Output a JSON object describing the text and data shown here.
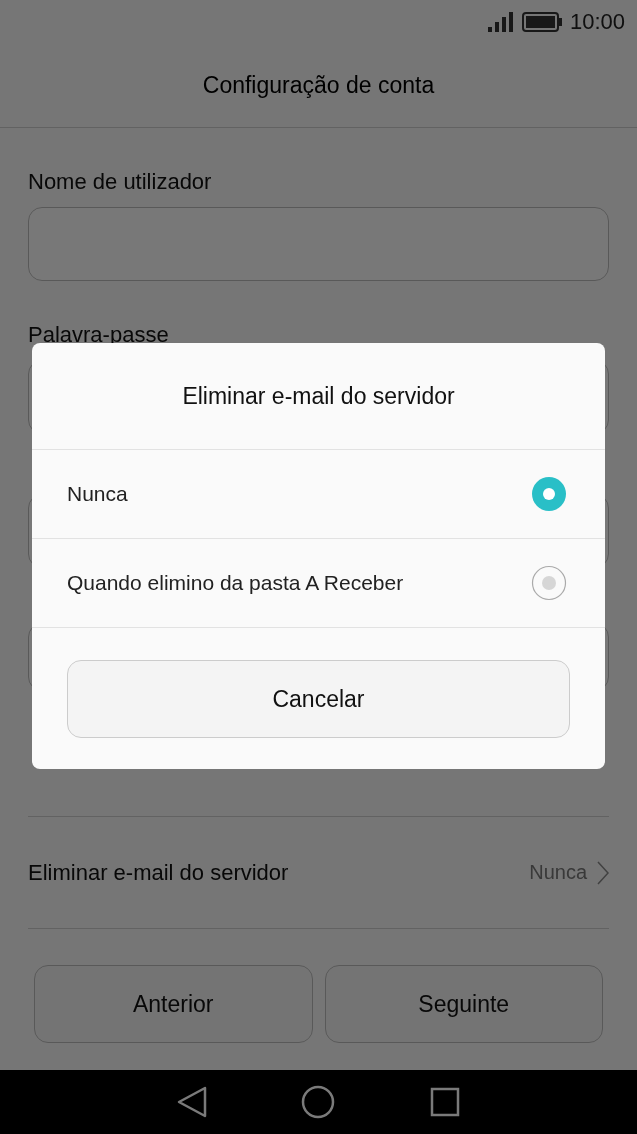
{
  "status_bar": {
    "time": "10:00"
  },
  "header": {
    "title": "Configuração de conta"
  },
  "fields": [
    {
      "label": "Nome de utilizador"
    },
    {
      "label": "Palavra-passe"
    }
  ],
  "setting_row": {
    "label": "Eliminar e-mail do servidor",
    "value": "Nunca"
  },
  "buttons": [
    "Anterior",
    "Seguinte"
  ],
  "dialog": {
    "title": "Eliminar e-mail do servidor",
    "options": [
      {
        "label": "Nunca",
        "selected": true
      },
      {
        "label": "Quando elimino da pasta A Receber",
        "selected": false
      }
    ],
    "cancel": "Cancelar"
  }
}
